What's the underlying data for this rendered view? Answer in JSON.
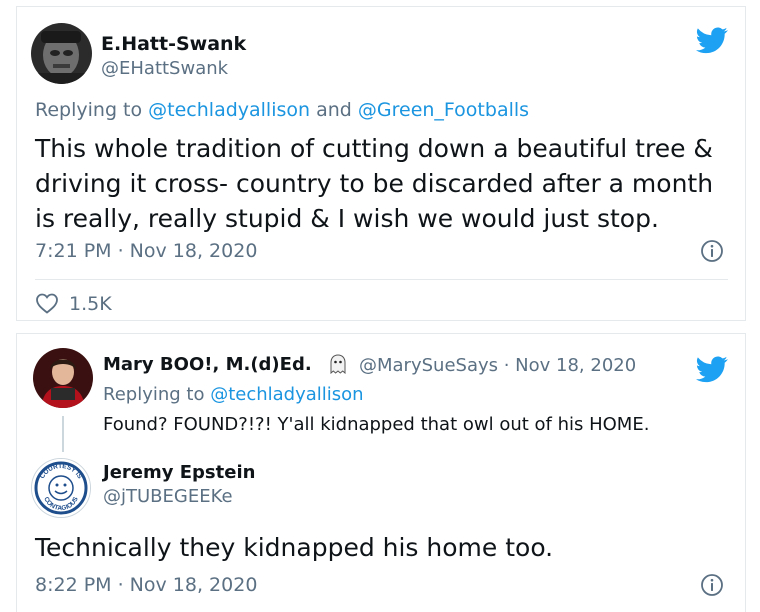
{
  "tweet1": {
    "name": "E.Hatt-Swank",
    "handle": "@EHattSwank",
    "replying_prefix": "Replying to ",
    "replying_user1": "@techladyallison",
    "replying_and": " and ",
    "replying_user2": "@Green_Footballs",
    "body_lines": [
      "This whole tradition of cutting down a beautiful tree &",
      "driving it cross- country to be discarded after a month",
      "is really, really stupid & I wish  we would just stop."
    ],
    "time": "7:21 PM · Nov 18, 2020",
    "likes": "1.5K"
  },
  "tweet2": {
    "name": "Mary BOO!, M.(d)Ed.",
    "handle_date": "@MarySueSays · Nov 18, 2020",
    "replying_prefix": "Replying to ",
    "replying_user": "@techladyallison",
    "body": "Found? FOUND?!?! Y'all kidnapped that owl out of his HOME."
  },
  "tweet3": {
    "name": "Jeremy Epstein",
    "handle": "@jTUBEGEEKe",
    "avatar_text_top": "COURTESY IS",
    "avatar_text_bottom": "CONTAGIOUS",
    "body": "Technically they kidnapped his home too.",
    "time": "8:22 PM · Nov 18, 2020"
  },
  "colors": {
    "brand_blue": "#1da1f2",
    "link_blue": "#1b95e0",
    "muted": "#5b7083"
  },
  "icons": [
    "twitter-bird-icon",
    "info-icon",
    "heart-icon",
    "ghost-icon"
  ]
}
